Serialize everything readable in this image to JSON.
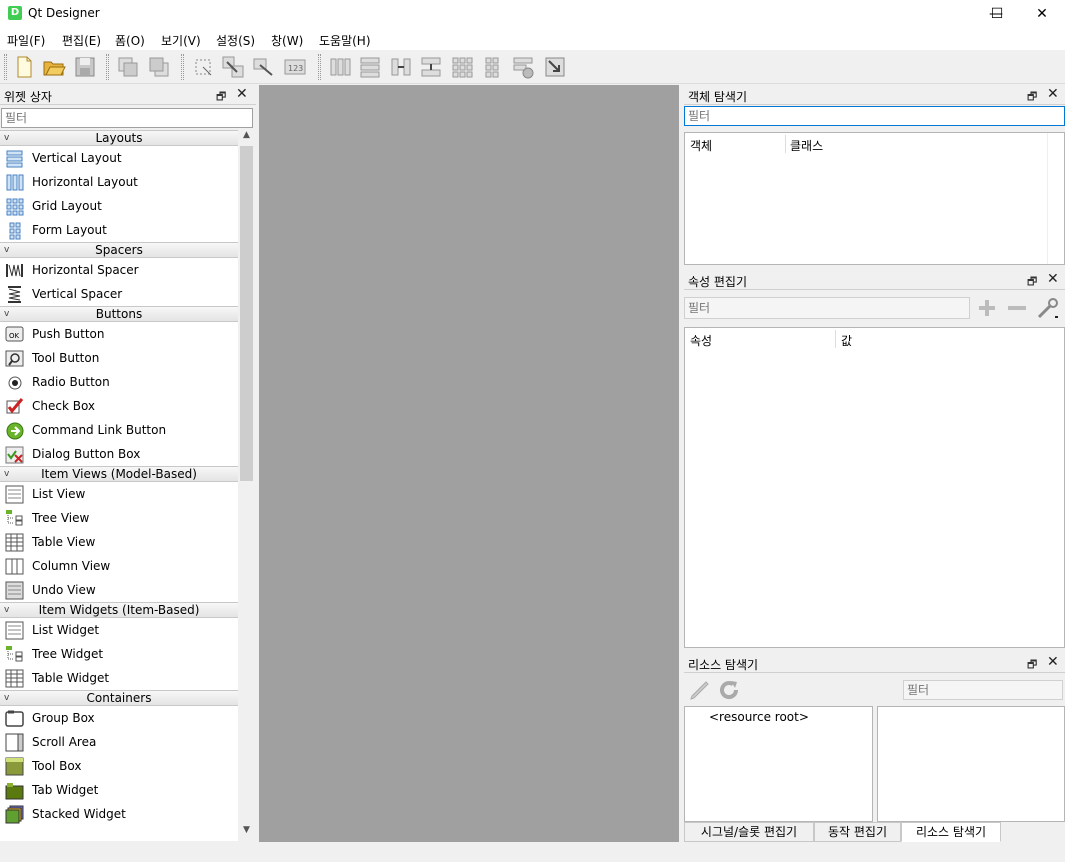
{
  "window": {
    "icon_letter": "D",
    "title": "Qt Designer",
    "minimize": "—",
    "maximize": "☐",
    "close": "✕"
  },
  "menu": [
    "파일(F)",
    "편집(E)",
    "폼(O)",
    "보기(V)",
    "설정(S)",
    "창(W)",
    "도움말(H)"
  ],
  "toolbar_icons": [
    "new-file-icon",
    "open-folder-icon",
    "save-icon",
    "send-to-back-icon",
    "bring-to-front-icon",
    "edit-widgets-icon",
    "edit-signals-slots-icon",
    "edit-buddies-icon",
    "edit-tab-order-icon",
    "lay-out-horizontally-icon",
    "lay-out-vertically-icon",
    "horizontal-splitter-icon",
    "vertical-splitter-icon",
    "lay-out-grid-icon",
    "lay-out-form-icon",
    "break-layout-icon",
    "adjust-size-icon"
  ],
  "widget_box": {
    "title": "위젯 상자",
    "float_icon": "🗗",
    "close_icon": "✕",
    "filter_placeholder": "필터",
    "scroll_up": "▲",
    "scroll_down": "▼",
    "categories": [
      {
        "name": "Layouts",
        "arrow": "v",
        "items": [
          {
            "label": "Vertical Layout",
            "icon": "vertical-layout-icon"
          },
          {
            "label": "Horizontal Layout",
            "icon": "horizontal-layout-icon"
          },
          {
            "label": "Grid Layout",
            "icon": "grid-layout-icon"
          },
          {
            "label": "Form Layout",
            "icon": "form-layout-icon"
          }
        ]
      },
      {
        "name": "Spacers",
        "arrow": "v",
        "items": [
          {
            "label": "Horizontal Spacer",
            "icon": "horizontal-spacer-icon"
          },
          {
            "label": "Vertical Spacer",
            "icon": "vertical-spacer-icon"
          }
        ]
      },
      {
        "name": "Buttons",
        "arrow": "v",
        "items": [
          {
            "label": "Push Button",
            "icon": "push-button-icon"
          },
          {
            "label": "Tool Button",
            "icon": "tool-button-icon"
          },
          {
            "label": "Radio Button",
            "icon": "radio-button-icon"
          },
          {
            "label": "Check Box",
            "icon": "check-box-icon"
          },
          {
            "label": "Command Link Button",
            "icon": "command-link-icon"
          },
          {
            "label": "Dialog Button Box",
            "icon": "dialog-button-box-icon"
          }
        ]
      },
      {
        "name": "Item Views (Model-Based)",
        "arrow": "v",
        "items": [
          {
            "label": "List View",
            "icon": "list-view-icon"
          },
          {
            "label": "Tree View",
            "icon": "tree-view-icon"
          },
          {
            "label": "Table View",
            "icon": "table-view-icon"
          },
          {
            "label": "Column View",
            "icon": "column-view-icon"
          },
          {
            "label": "Undo View",
            "icon": "undo-view-icon"
          }
        ]
      },
      {
        "name": "Item Widgets (Item-Based)",
        "arrow": "v",
        "items": [
          {
            "label": "List Widget",
            "icon": "list-widget-icon"
          },
          {
            "label": "Tree Widget",
            "icon": "tree-widget-icon"
          },
          {
            "label": "Table Widget",
            "icon": "table-widget-icon"
          }
        ]
      },
      {
        "name": "Containers",
        "arrow": "v",
        "items": [
          {
            "label": "Group Box",
            "icon": "group-box-icon"
          },
          {
            "label": "Scroll Area",
            "icon": "scroll-area-icon"
          },
          {
            "label": "Tool Box",
            "icon": "tool-box-icon"
          },
          {
            "label": "Tab Widget",
            "icon": "tab-widget-icon"
          },
          {
            "label": "Stacked Widget",
            "icon": "stacked-widget-icon"
          }
        ]
      }
    ]
  },
  "object_inspector": {
    "title": "객체 탐색기",
    "filter_placeholder": "필터",
    "col_object": "객체",
    "col_class": "클래스"
  },
  "property_editor": {
    "title": "속성 편집기",
    "filter_placeholder": "필터",
    "col_property": "속성",
    "col_value": "값",
    "add_icon": "plus-icon",
    "remove_icon": "minus-icon",
    "config_icon": "wrench-icon"
  },
  "resource_browser": {
    "title": "리소스 탐색기",
    "filter_placeholder": "필터",
    "root": "<resource root>",
    "edit_icon": "pencil-icon",
    "reload_icon": "reload-icon"
  },
  "bottom_tabs": [
    "시그널/슬롯 편집기",
    "동작 편집기",
    "리소스 탐색기"
  ],
  "active_tab": "리소스 탐색기",
  "colors": {
    "central_bg": "#a0a0a0",
    "app_icon": "#41cd52",
    "focus_border": "#0078d7"
  }
}
